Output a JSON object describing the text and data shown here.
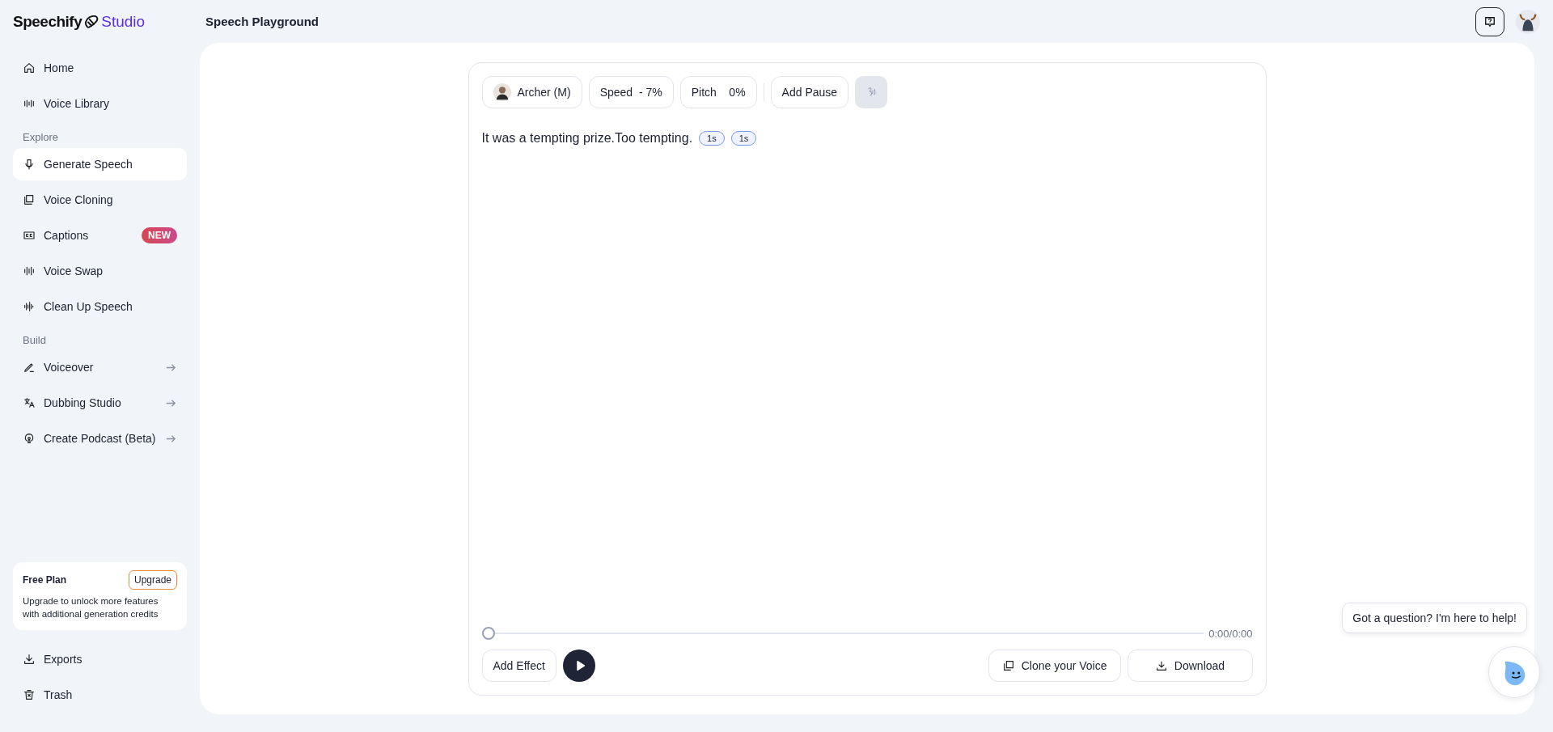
{
  "brand": {
    "name": "Speechify",
    "product": "Studio"
  },
  "page_title": "Speech Playground",
  "sidebar": {
    "groups": [
      {
        "items": [
          {
            "label": "Home",
            "selected": false,
            "arrow": false
          },
          {
            "label": "Voice Library",
            "selected": false,
            "arrow": false
          }
        ]
      },
      {
        "heading": "Explore",
        "items": [
          {
            "label": "Generate Speech",
            "selected": true,
            "arrow": false
          },
          {
            "label": "Voice Cloning",
            "selected": false,
            "arrow": false
          },
          {
            "label": "Captions",
            "selected": false,
            "arrow": false,
            "badge": "NEW"
          },
          {
            "label": "Voice Swap",
            "selected": false,
            "arrow": false
          },
          {
            "label": "Clean Up Speech",
            "selected": false,
            "arrow": false
          }
        ]
      },
      {
        "heading": "Build",
        "items": [
          {
            "label": "Voiceover",
            "selected": false,
            "arrow": true
          },
          {
            "label": "Dubbing Studio",
            "selected": false,
            "arrow": true
          },
          {
            "label": "Create Podcast (Beta)",
            "selected": false,
            "arrow": true
          }
        ]
      }
    ],
    "plan": {
      "title": "Free Plan",
      "button": "Upgrade",
      "text": "Upgrade to unlock more features with additional generation credits"
    },
    "footer_items": [
      {
        "label": "Exports",
        "selected": false
      },
      {
        "label": "Trash",
        "selected": false
      }
    ]
  },
  "editor": {
    "voice": "Archer (M)",
    "speed": {
      "label": "Speed",
      "value": "- 7%"
    },
    "pitch": {
      "label": "Pitch",
      "value": "0%"
    },
    "add_pause": "Add Pause",
    "effect_toggle": {
      "disabled": true
    },
    "text": "It was a tempting prize.Too tempting.",
    "pauses": [
      "1s",
      "1s"
    ],
    "player": {
      "level": 0,
      "time": "0:00/0:00"
    },
    "add_effect": "Add Effect",
    "clone_voice": "Clone your Voice",
    "download": "Download"
  },
  "help": {
    "message": "Got a question? I'm here to help!"
  }
}
